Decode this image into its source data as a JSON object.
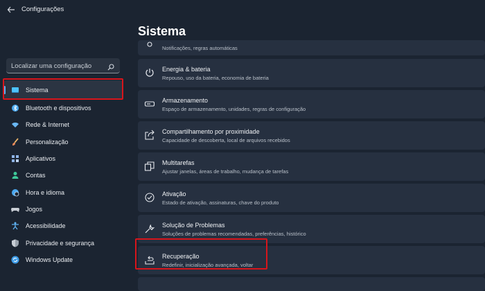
{
  "window": {
    "title": "Configurações"
  },
  "search": {
    "placeholder": "Localizar uma configuração"
  },
  "sidebar": {
    "items": [
      {
        "label": "Sistema",
        "icon": "monitor-icon",
        "color": "#4cc2ff"
      },
      {
        "label": "Bluetooth e dispositivos",
        "icon": "bluetooth-icon",
        "color": "#4aa8f0"
      },
      {
        "label": "Rede & Internet",
        "icon": "wifi-icon",
        "color": "#6ab7f5"
      },
      {
        "label": "Personalização",
        "icon": "brush-icon",
        "color": "#f0a060"
      },
      {
        "label": "Aplicativos",
        "icon": "apps-icon",
        "color": "#8fb4e6"
      },
      {
        "label": "Contas",
        "icon": "person-icon",
        "color": "#3ec99a"
      },
      {
        "label": "Hora e idioma",
        "icon": "globe-clock-icon",
        "color": "#4aa8f0"
      },
      {
        "label": "Jogos",
        "icon": "gamepad-icon",
        "color": "#c9ced5"
      },
      {
        "label": "Acessibilidade",
        "icon": "accessibility-icon",
        "color": "#5fb2f2"
      },
      {
        "label": "Privacidade e segurança",
        "icon": "shield-icon",
        "color": "#9aa3ae"
      },
      {
        "label": "Windows Update",
        "icon": "update-icon",
        "color": "#3f9de8"
      }
    ]
  },
  "main": {
    "title": "Sistema",
    "items": [
      {
        "title": "",
        "subtitle": "Notificações, regras automáticas",
        "icon": "focus-icon"
      },
      {
        "title": "Energia & bateria",
        "subtitle": "Repouso, uso da bateria, economia de bateria",
        "icon": "power-icon"
      },
      {
        "title": "Armazenamento",
        "subtitle": "Espaço de armazenamento, unidades, regras de configuração",
        "icon": "storage-icon"
      },
      {
        "title": "Compartilhamento por proximidade",
        "subtitle": "Capacidade de descoberta, local de arquivos recebidos",
        "icon": "share-icon"
      },
      {
        "title": "Multitarefas",
        "subtitle": "Ajustar janelas, áreas de trabalho, mudança de tarefas",
        "icon": "multitask-icon"
      },
      {
        "title": "Ativação",
        "subtitle": "Estado de ativação, assinaturas, chave do produto",
        "icon": "check-circle-icon"
      },
      {
        "title": "Solução de Problemas",
        "subtitle": "Soluções de problemas recomendadas, preferências, histórico",
        "icon": "wrench-icon"
      },
      {
        "title": "Recuperação",
        "subtitle": "Redefinir, inicialização avançada, voltar",
        "icon": "recovery-icon"
      }
    ]
  },
  "colors": {
    "highlight": "#d8151b",
    "accent": "#5fb2f2"
  }
}
